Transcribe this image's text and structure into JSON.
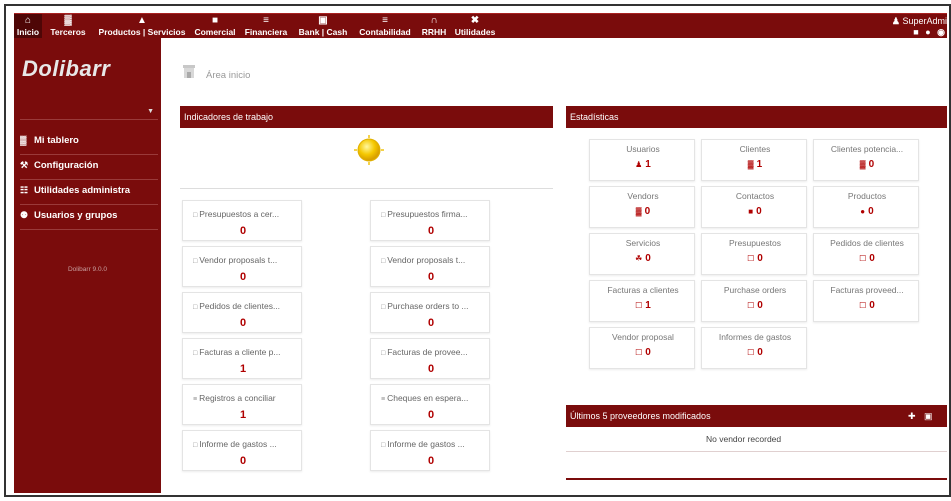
{
  "topmenu": {
    "items": [
      {
        "label": "Inicio",
        "icon": "home-icon",
        "glyph": "⌂",
        "active": true
      },
      {
        "label": "Terceros",
        "icon": "chart-icon",
        "glyph": "▓"
      },
      {
        "label": "Productos | Servicios",
        "icon": "cube-icon",
        "glyph": "▲"
      },
      {
        "label": "Comercial",
        "icon": "suitcase-icon",
        "glyph": "■"
      },
      {
        "label": "Financiera",
        "icon": "money-icon",
        "glyph": "≡"
      },
      {
        "label": "Bank | Cash",
        "icon": "bank-icon",
        "glyph": "▣"
      },
      {
        "label": "Contabilidad",
        "icon": "ledger-icon",
        "glyph": "≡"
      },
      {
        "label": "RRHH",
        "icon": "people-icon",
        "glyph": "∩"
      },
      {
        "label": "Utilidades",
        "icon": "wrench-icon",
        "glyph": "✖"
      }
    ],
    "user": "SuperAdmi",
    "user_icons": "■ ● ◉"
  },
  "sidebar": {
    "logo": "Dolibarr",
    "items": [
      {
        "label": "Mi tablero",
        "glyph": "▓"
      },
      {
        "label": "Configuración",
        "glyph": "⚒"
      },
      {
        "label": "Utilidades administra",
        "glyph": "☷"
      },
      {
        "label": "Usuarios y grupos",
        "glyph": "⚉"
      }
    ],
    "version": "Dolibarr 9.0.0"
  },
  "breadcrumb": {
    "text": "Área inicio"
  },
  "work_panel": {
    "title": "Indicadores de trabajo",
    "cards": [
      {
        "label": "Presupuestos a cer...",
        "value": "0",
        "red": true
      },
      {
        "label": "Presupuestos firma...",
        "value": "0",
        "red": true
      },
      {
        "label": "Vendor proposals t...",
        "value": "0",
        "red": true
      },
      {
        "label": "Vendor proposals t...",
        "value": "0",
        "red": true
      },
      {
        "label": "Pedidos de clientes...",
        "value": "0",
        "red": true
      },
      {
        "label": "Purchase orders to ...",
        "value": "0",
        "red": true
      },
      {
        "label": "Facturas a cliente p...",
        "value": "1",
        "red": true
      },
      {
        "label": "Facturas de provee...",
        "value": "0",
        "red": true
      },
      {
        "label": "Registros a conciliar",
        "value": "1",
        "red": true
      },
      {
        "label": "Cheques en espera...",
        "value": "0",
        "red": true
      },
      {
        "label": "Informe de gastos ...",
        "value": "0",
        "red": true
      },
      {
        "label": "Informe de gastos ...",
        "value": "0",
        "red": true
      }
    ]
  },
  "stats_panel": {
    "title": "Estadísticas",
    "items": [
      {
        "label": "Usuarios",
        "value": "1",
        "glyph": "♟"
      },
      {
        "label": "Clientes",
        "value": "1",
        "glyph": "▓"
      },
      {
        "label": "Clientes potencia...",
        "value": "0",
        "glyph": "▓"
      },
      {
        "label": "Vendors",
        "value": "0",
        "glyph": "▓"
      },
      {
        "label": "Contactos",
        "value": "0",
        "glyph": "■"
      },
      {
        "label": "Productos",
        "value": "0",
        "glyph": "●"
      },
      {
        "label": "Servicios",
        "value": "0",
        "glyph": "☘"
      },
      {
        "label": "Presupuestos",
        "value": "0",
        "glyph": "☐"
      },
      {
        "label": "Pedidos de clientes",
        "value": "0",
        "glyph": "☐"
      },
      {
        "label": "Facturas a clientes",
        "value": "1",
        "glyph": "☐"
      },
      {
        "label": "Purchase orders",
        "value": "0",
        "glyph": "☐"
      },
      {
        "label": "Facturas proveed...",
        "value": "0",
        "glyph": "☐"
      },
      {
        "label": "Vendor proposal",
        "value": "0",
        "glyph": "☐"
      },
      {
        "label": "Informes de gastos",
        "value": "0",
        "glyph": "☐"
      }
    ]
  },
  "vendors_panel": {
    "title": "Últimos 5 proveedores modificados",
    "empty_text": "No vendor recorded",
    "icons": "✚ ▣"
  }
}
